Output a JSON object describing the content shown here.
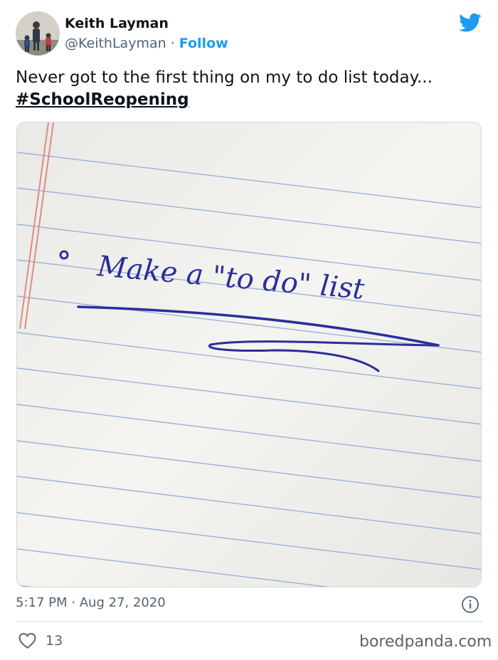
{
  "author": {
    "name": "Keith Layman",
    "handle": "@KeithLayman",
    "separator": "·",
    "follow_label": "Follow"
  },
  "tweet": {
    "text": "Never got to the first thing on my to do list today...",
    "hashtag": "#SchoolReopening"
  },
  "photo": {
    "handwriting": "Make a \"to do\" list"
  },
  "meta": {
    "time": "5:17 PM",
    "separator": "·",
    "date": "Aug 27, 2020"
  },
  "engagement": {
    "likes": "13"
  },
  "watermark": "boredpanda.com",
  "colors": {
    "accent": "#1d9bf0",
    "text": "#0f1419",
    "secondary": "#536471",
    "ink": "#2a2f9a",
    "paper": "#f1f1ee",
    "rule": "#8fa9d2",
    "margin": "#e08a86"
  },
  "icons": {
    "brand": "twitter-bird-icon",
    "info": "info-icon",
    "like": "heart-icon"
  }
}
